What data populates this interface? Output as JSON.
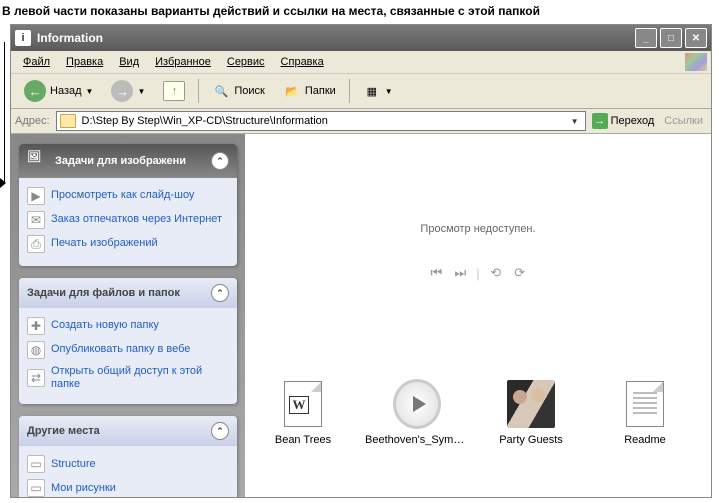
{
  "caption": "В левой части показаны варианты действий и ссылки на места, связанные с этой папкой",
  "window": {
    "title": "Information"
  },
  "menu": {
    "file": "Файл",
    "edit": "Правка",
    "view": "Вид",
    "favorites": "Избранное",
    "tools": "Сервис",
    "help": "Справка"
  },
  "toolbar": {
    "back": "Назад",
    "search": "Поиск",
    "folders": "Папки"
  },
  "address": {
    "label": "Адрес:",
    "value": "D:\\Step By Step\\Win_XP-CD\\Structure\\Information",
    "go": "Переход",
    "links": "Ссылки"
  },
  "panels": {
    "images": {
      "title": "Задачи для изображени",
      "items": [
        "Просмотреть как слайд-шоу",
        "Заказ отпечатков через Интернет",
        "Печать изображений"
      ]
    },
    "files": {
      "title": "Задачи для файлов и папок",
      "items": [
        "Создать новую папку",
        "Опубликовать папку в вебе",
        "Открыть общий доступ к этой папке"
      ]
    },
    "places": {
      "title": "Другие места",
      "items": [
        "Structure",
        "Мои рисунки"
      ]
    }
  },
  "preview": {
    "message": "Просмотр недоступен."
  },
  "files": [
    {
      "label": "Bean Trees",
      "type": "word"
    },
    {
      "label": "Beethoven's_Symphon...",
      "type": "media"
    },
    {
      "label": "Party Guests",
      "type": "photo"
    },
    {
      "label": "Readme",
      "type": "text"
    }
  ]
}
